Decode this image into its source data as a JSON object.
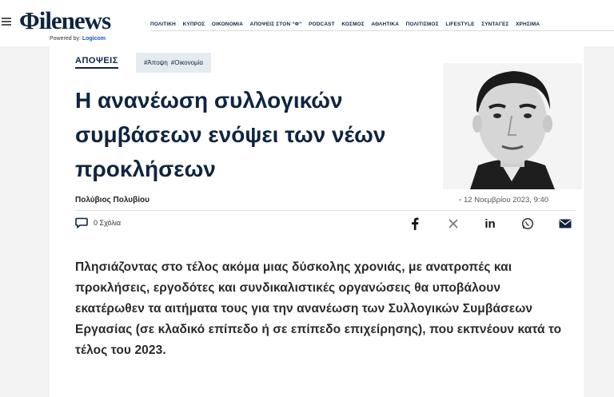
{
  "header": {
    "logo": "Φilenews",
    "powered_by_prefix": "Powered by: ",
    "powered_by_brand": "Logicom",
    "nav": [
      "ΠΟΛΙΤΙΚΗ",
      "ΚΥΠΡΟΣ",
      "ΟΙΚΟΝΟΜΙΑ",
      "ΑΠΟΨΕΙΣ ΣΤΟΝ “Φ”",
      "PODCAST",
      "ΚΟΣΜΟΣ",
      "ΑΘΛΗΤΙΚΑ",
      "ΠΟΛΙΤΙΣΜΟΣ",
      "LIFESTYLE",
      "ΣΥΝΤΑΓΕΣ",
      "ΧΡΗΣΙΜΑ"
    ]
  },
  "article": {
    "section": "ΑΠΟΨΕΙΣ",
    "tags": [
      "#Άποψη",
      "#Οικονομία"
    ],
    "headline": "Η ανανέωση συλλογικών συμβάσεων ενόψει των νέων προκλήσεων",
    "author": "Πολύβιος Πολυβίου",
    "date": "12 Νοεμβρίου 2023, 9:40",
    "comments": "0 Σχόλια",
    "share_icons": [
      "facebook-icon",
      "x-icon",
      "linkedin-icon",
      "whatsapp-icon",
      "email-icon"
    ],
    "body": "Πλησιάζοντας στο τέλος ακόμα μιας δύσκολης χρονιάς, με ανατροπές και προκλήσεις, εργοδότες και συνδικαλιστικές οργανώσεις θα υποβάλουν εκατέρωθεν τα αιτήματα τους για την ανανέωση των Συλλογικών Συμβάσεων Εργασίας (σε κλαδικό επίπεδο ή σε επίπεδο επιχείρησης), που εκπνέουν κατά το τέλος του 2023."
  },
  "colors": {
    "brand": "#0f2540",
    "tag_bg": "#e6ebf2",
    "powered_brand": "#1a57c7"
  }
}
